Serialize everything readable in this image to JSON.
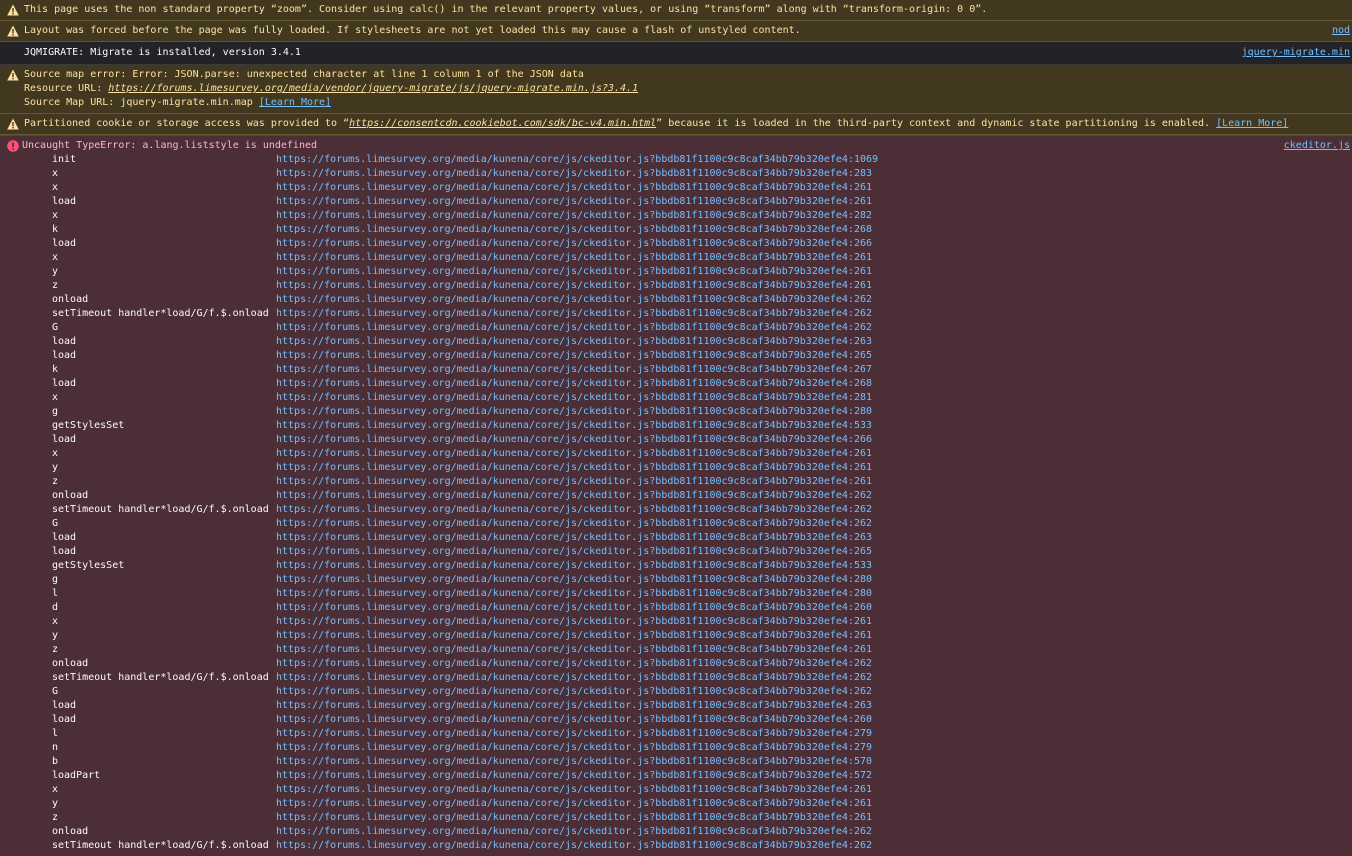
{
  "messages": {
    "zoom_warning": "This page uses the non standard property “zoom”. Consider using calc() in the relevant property values, or using “transform” along with “transform-origin: 0 0”.",
    "layout_warning": "Layout was forced before the page was fully loaded. If stylesheets are not yet loaded this may cause a flash of unstyled content.",
    "layout_source": "nod",
    "jqmigrate_log": "JQMIGRATE: Migrate is installed, version 3.4.1",
    "jqmigrate_source": "jquery-migrate.min",
    "sourcemap_error": "Source map error: Error: JSON.parse: unexpected character at line 1 column 1 of the JSON data",
    "resource_url_label": "Resource URL: ",
    "resource_url": "https://forums.limesurvey.org/media/vendor/jquery-migrate/js/jquery-migrate.min.js?3.4.1",
    "sourcemap_url_label": "Source Map URL: jquery-migrate.min.map ",
    "learn_more": "[Learn More]",
    "partition_prefix": "Partitioned cookie or storage access was provided to “",
    "partition_url": "https://consentcdn.cookiebot.com/sdk/bc-v4.min.html",
    "partition_suffix": "” because it is loaded in the third-party context and dynamic state partitioning is enabled. ",
    "error_text": "Uncaught TypeError: a.lang.liststyle is undefined",
    "error_source": "ckeditor.js"
  },
  "frame_url": "https://forums.limesurvey.org/media/kunena/core/js/ckeditor.js?bbdb81f1100c9c8caf34bb79b320efe4",
  "frames": [
    [
      "init",
      "1069"
    ],
    [
      "x",
      "283"
    ],
    [
      "x",
      "261"
    ],
    [
      "load",
      "261"
    ],
    [
      "x",
      "282"
    ],
    [
      "k",
      "268"
    ],
    [
      "load",
      "266"
    ],
    [
      "x",
      "261"
    ],
    [
      "y",
      "261"
    ],
    [
      "z",
      "261"
    ],
    [
      "onload",
      "262"
    ],
    [
      "setTimeout handler*load/G/f.$.onload",
      "262"
    ],
    [
      "G",
      "262"
    ],
    [
      "load",
      "263"
    ],
    [
      "load",
      "265"
    ],
    [
      "k",
      "267"
    ],
    [
      "load",
      "268"
    ],
    [
      "x",
      "281"
    ],
    [
      "g",
      "280"
    ],
    [
      "getStylesSet",
      "533"
    ],
    [
      "load",
      "266"
    ],
    [
      "x",
      "261"
    ],
    [
      "y",
      "261"
    ],
    [
      "z",
      "261"
    ],
    [
      "onload",
      "262"
    ],
    [
      "setTimeout handler*load/G/f.$.onload",
      "262"
    ],
    [
      "G",
      "262"
    ],
    [
      "load",
      "263"
    ],
    [
      "load",
      "265"
    ],
    [
      "getStylesSet",
      "533"
    ],
    [
      "g",
      "280"
    ],
    [
      "l",
      "280"
    ],
    [
      "d",
      "260"
    ],
    [
      "x",
      "261"
    ],
    [
      "y",
      "261"
    ],
    [
      "z",
      "261"
    ],
    [
      "onload",
      "262"
    ],
    [
      "setTimeout handler*load/G/f.$.onload",
      "262"
    ],
    [
      "G",
      "262"
    ],
    [
      "load",
      "263"
    ],
    [
      "load",
      "260"
    ],
    [
      "l",
      "279"
    ],
    [
      "n",
      "279"
    ],
    [
      "b",
      "570"
    ],
    [
      "loadPart",
      "572"
    ],
    [
      "x",
      "261"
    ],
    [
      "y",
      "261"
    ],
    [
      "z",
      "261"
    ],
    [
      "onload",
      "262"
    ],
    [
      "setTimeout handler*load/G/f.$.onload",
      "262"
    ]
  ],
  "colors": {
    "warning_bg": "#42381f",
    "error_bg": "#4b2e36",
    "link": "#75bfff"
  }
}
